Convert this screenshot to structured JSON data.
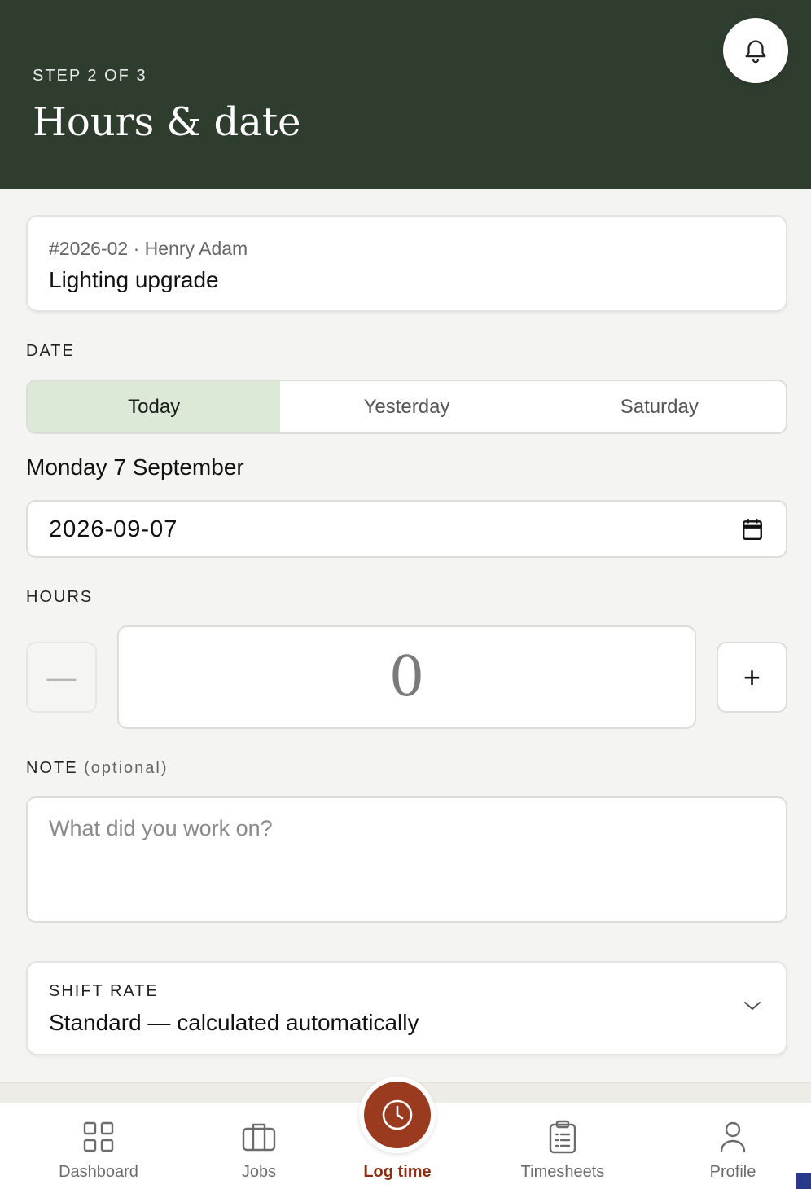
{
  "header": {
    "step": "STEP 2 OF 3",
    "title": "Hours & date"
  },
  "job": {
    "meta": "#2026-02 · Henry Adam",
    "name": "Lighting upgrade"
  },
  "date_section": {
    "label": "DATE",
    "options": [
      "Today",
      "Yesterday",
      "Saturday"
    ],
    "selected": "Today",
    "long_date": "Monday 7 September",
    "input_value": "2026-09-07"
  },
  "hours_section": {
    "label": "HOURS",
    "value": "0",
    "minus": "—",
    "plus": "+"
  },
  "note_section": {
    "label": "NOTE",
    "optional": "(optional)",
    "placeholder": "What did you work on?"
  },
  "shift_rate": {
    "label": "SHIFT RATE",
    "value": "Standard — calculated automatically"
  },
  "nav": {
    "items": [
      "Dashboard",
      "Jobs",
      "Log time",
      "Timesheets",
      "Profile"
    ],
    "active": "Log time"
  },
  "colors": {
    "header_bg": "#2f3d2f",
    "accent": "#9a3a1f",
    "segment_active": "#dbe9d6"
  },
  "icons": {
    "notification": "bell-icon",
    "calendar": "calendar-icon",
    "dropdown": "chevron-down-icon",
    "dashboard": "grid-icon",
    "jobs": "briefcase-icon",
    "log_time": "clock-icon",
    "timesheets": "clipboard-icon",
    "profile": "user-icon"
  }
}
